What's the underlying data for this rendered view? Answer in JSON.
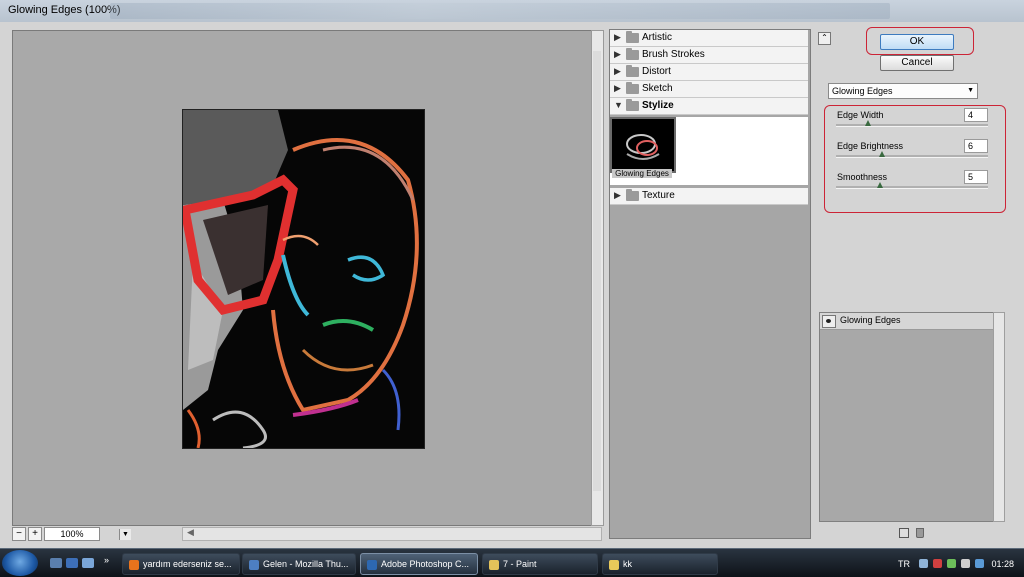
{
  "window": {
    "title": "Glowing Edges (100%)"
  },
  "preview": {
    "zoom": "100%",
    "zoom_in": "+",
    "zoom_out": "−"
  },
  "filter_gallery": {
    "categories": [
      {
        "label": "Artistic",
        "open": false
      },
      {
        "label": "Brush Strokes",
        "open": false
      },
      {
        "label": "Distort",
        "open": false
      },
      {
        "label": "Sketch",
        "open": false
      },
      {
        "label": "Stylize",
        "open": true
      },
      {
        "label": "Texture",
        "open": false
      }
    ],
    "selected_thumbnail": "Glowing Edges"
  },
  "buttons": {
    "ok": "OK",
    "cancel": "Cancel"
  },
  "filter_select": {
    "value": "Glowing Edges"
  },
  "params": [
    {
      "label": "Edge Width",
      "value": "4",
      "slider_fraction": 0.21
    },
    {
      "label": "Edge Brightness",
      "value": "6",
      "slider_fraction": 0.3
    },
    {
      "label": "Smoothness",
      "value": "5",
      "slider_fraction": 0.29
    }
  ],
  "layers": [
    {
      "name": "Glowing Edges"
    }
  ],
  "taskbar": {
    "items": [
      {
        "label": "yardım ederseniz se...",
        "icon": "firefox-icon",
        "color": "#e8731c"
      },
      {
        "label": "Gelen - Mozilla Thu...",
        "icon": "thunderbird-icon",
        "color": "#4d7fc2"
      },
      {
        "label": "Adobe Photoshop C...",
        "icon": "photoshop-icon",
        "color": "#2d68b1"
      },
      {
        "label": "7 - Paint",
        "icon": "paint-icon",
        "color": "#e3c25a"
      },
      {
        "label": "kk",
        "icon": "folder-icon",
        "color": "#e8c95a"
      }
    ],
    "language": "TR",
    "clock": "01:28"
  }
}
